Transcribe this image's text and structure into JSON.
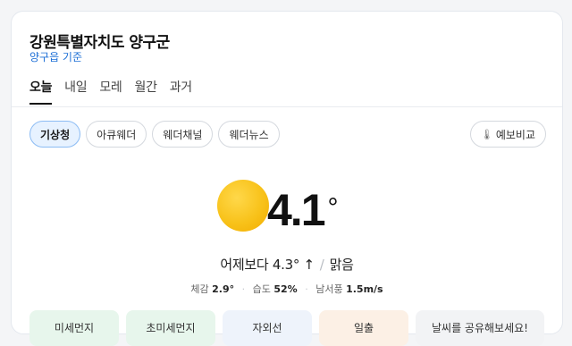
{
  "location": {
    "title": "강원특별자치도 양구군",
    "subtitle": "양구읍 기준"
  },
  "tabs": [
    {
      "label": "오늘",
      "active": true
    },
    {
      "label": "내일",
      "active": false
    },
    {
      "label": "모레",
      "active": false
    },
    {
      "label": "월간",
      "active": false
    },
    {
      "label": "과거",
      "active": false
    }
  ],
  "sources": [
    {
      "label": "기상청",
      "active": true
    },
    {
      "label": "아큐웨더",
      "active": false
    },
    {
      "label": "웨더채널",
      "active": false
    },
    {
      "label": "웨더뉴스",
      "active": false
    }
  ],
  "compare_label": "예보비교",
  "current": {
    "icon": "sun-icon",
    "temperature": "4.1",
    "degree_symbol": "°",
    "compare_text": "어제보다 4.3° ↑",
    "condition": "맑음",
    "feels_like_label": "체감",
    "feels_like_value": "2.9°",
    "humidity_label": "습도",
    "humidity_value": "52%",
    "wind_label": "남서풍",
    "wind_value": "1.5m/s"
  },
  "indicators": [
    {
      "label": "미세먼지"
    },
    {
      "label": "초미세먼지"
    },
    {
      "label": "자외선"
    },
    {
      "label": "일출"
    },
    {
      "label": "날씨를 공유해보세요!"
    }
  ],
  "colors": {
    "accent": "#1d6fd6",
    "sun": "#f8c21a",
    "chip_active_bg": "#e7f2ff"
  }
}
